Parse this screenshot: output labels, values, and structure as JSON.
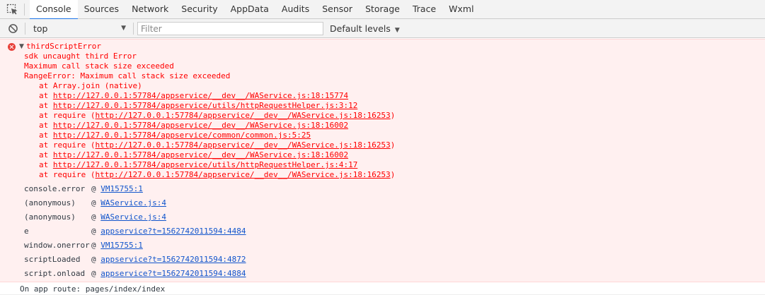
{
  "tabs": [
    "Console",
    "Sources",
    "Network",
    "Security",
    "AppData",
    "Audits",
    "Sensor",
    "Storage",
    "Trace",
    "Wxml"
  ],
  "filterbar": {
    "context": "top",
    "filter_placeholder": "Filter",
    "levels": "Default levels"
  },
  "error": {
    "title": "thirdScriptError",
    "messages": [
      "sdk uncaught third Error",
      "Maximum call stack size exceeded",
      "RangeError: Maximum call stack size exceeded"
    ],
    "frames": [
      {
        "prefix": "at Array.join (native)",
        "link": "",
        "suffix": ""
      },
      {
        "prefix": "at ",
        "link": "http://127.0.0.1:57784/appservice/__dev__/WAService.js:18:15774",
        "suffix": ""
      },
      {
        "prefix": "at ",
        "link": "http://127.0.0.1:57784/appservice/utils/httpRequestHelper.js:3:12",
        "suffix": ""
      },
      {
        "prefix": "at require (",
        "link": "http://127.0.0.1:57784/appservice/__dev__/WAService.js:18:16253",
        "suffix": ")"
      },
      {
        "prefix": "at ",
        "link": "http://127.0.0.1:57784/appservice/__dev__/WAService.js:18:16002",
        "suffix": ""
      },
      {
        "prefix": "at ",
        "link": "http://127.0.0.1:57784/appservice/common/common.js:5:25",
        "suffix": ""
      },
      {
        "prefix": "at require (",
        "link": "http://127.0.0.1:57784/appservice/__dev__/WAService.js:18:16253",
        "suffix": ")"
      },
      {
        "prefix": "at ",
        "link": "http://127.0.0.1:57784/appservice/__dev__/WAService.js:18:16002",
        "suffix": ""
      },
      {
        "prefix": "at ",
        "link": "http://127.0.0.1:57784/appservice/utils/httpRequestHelper.js:4:17",
        "suffix": ""
      },
      {
        "prefix": "at require (",
        "link": "http://127.0.0.1:57784/appservice/__dev__/WAService.js:18:16253",
        "suffix": ")"
      }
    ],
    "stack": [
      {
        "fn": "console.error",
        "at": "@ ",
        "link": "VM15755:1"
      },
      {
        "fn": "(anonymous)",
        "at": "@ ",
        "link": "WAService.js:4"
      },
      {
        "fn": "(anonymous)",
        "at": "@ ",
        "link": "WAService.js:4"
      },
      {
        "fn": "e",
        "at": "@ ",
        "link": "appservice?t=1562742011594:4484"
      },
      {
        "fn": "window.onerror",
        "at": "@ ",
        "link": "VM15755:1"
      },
      {
        "fn": "scriptLoaded",
        "at": "@ ",
        "link": "appservice?t=1562742011594:4872"
      },
      {
        "fn": "script.onload",
        "at": "@ ",
        "link": "appservice?t=1562742011594:4884"
      }
    ]
  },
  "log": "On app route: pages/index/index",
  "colors": {
    "error_text": "#ff0000",
    "error_bg": "#fff0f0",
    "active_tab_underline": "#1a73e8",
    "link": "#1155cc"
  }
}
